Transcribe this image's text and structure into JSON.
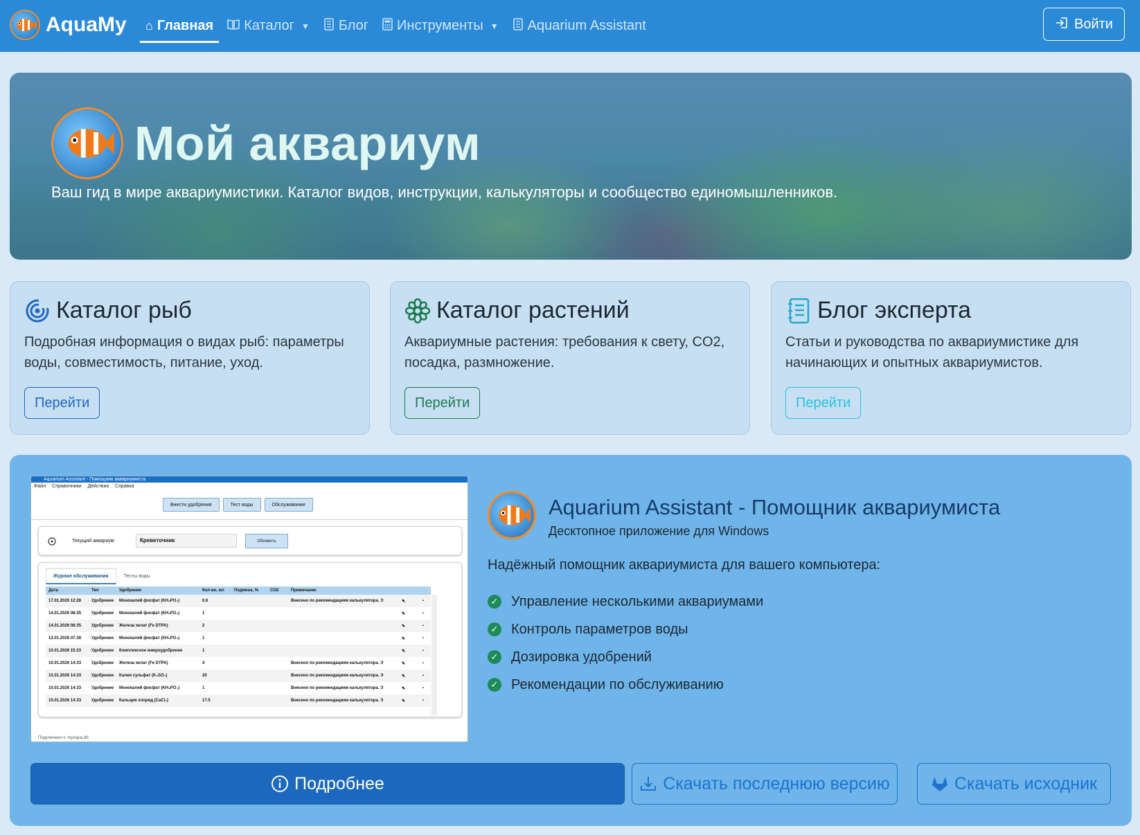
{
  "navbar": {
    "brand": "AquaMy",
    "links": [
      {
        "label": "Главная",
        "icon": "home-icon",
        "active": true
      },
      {
        "label": "Каталог",
        "icon": "book-icon",
        "dropdown": true
      },
      {
        "label": "Блог",
        "icon": "journal-icon"
      },
      {
        "label": "Инструменты",
        "icon": "calculator-icon",
        "dropdown": true
      },
      {
        "label": "Aquarium Assistant",
        "icon": "journal-icon"
      }
    ],
    "login": "Войти"
  },
  "hero": {
    "title": "Мой аквариум",
    "subtitle": "Ваш гид в мире аквариумистики. Каталог видов, инструкции, калькуляторы и сообщество единомышленников."
  },
  "cards": [
    {
      "title": "Каталог рыб",
      "icon": "fish-catalog-icon",
      "text": "Подробная информация о видах рыб: параметры воды, совместимость, питание, уход.",
      "button": "Перейти",
      "color": "#1f67c5"
    },
    {
      "title": "Каталог растений",
      "icon": "flower-icon",
      "text": "Аквариумные растения: требования к свету, CO2, посадка, размножение.",
      "button": "Перейти",
      "color": "#1c7a4d"
    },
    {
      "title": "Блог эксперта",
      "icon": "journal-icon",
      "text": "Статьи и руководства по аквариумистике для начинающих и опытных аквариумистов.",
      "button": "Перейти",
      "color": "#27c3de"
    }
  ],
  "assistant": {
    "title": "Aquarium Assistant - Помощник аквариумиста",
    "subtitle": "Десктопное приложение для Windows",
    "lead": "Надёжный помощник аквариумиста для вашего компьютера:",
    "features": [
      "Управление несколькими аквариумами",
      "Контроль параметров воды",
      "Дозировка удобрений",
      "Рекомендации по обслуживанию"
    ],
    "buttons": {
      "more": "Подробнее",
      "download": "Скачать последнюю версию",
      "source": "Скачать исходник"
    }
  },
  "screenshot": {
    "title": "Aquarium Assistant - Помощник аквариумиста",
    "menu": [
      "Файл",
      "Справочники",
      "Действия",
      "Справка"
    ],
    "toolbar": [
      "Внести удобрения",
      "Тест воды",
      "Обслуживание"
    ],
    "current_label": "Текущий аквариум:",
    "current_value": "Креветочник",
    "refresh": "Обновить",
    "tabs": [
      "Журнал обслуживания",
      "Тесты воды"
    ],
    "columns": [
      "Дата",
      "Тип",
      "Удобрение",
      "Кол-во, мл",
      "Подмена, %",
      "CO2",
      "Примечание"
    ],
    "rows": [
      [
        "17.01.2026 12:28",
        "Удобрение",
        "Монокалий фосфат (KH₂PO₄)",
        "0.6",
        "",
        "",
        "Внесено по рекомендациям калькулятора. Э"
      ],
      [
        "14.01.2026 08:35",
        "Удобрение",
        "Монокалий фосфат (KH₂PO₄)",
        "1",
        "",
        "",
        ""
      ],
      [
        "14.01.2026 08:35",
        "Удобрение",
        "Железа хелат (Fe DTPA)",
        "2",
        "",
        "",
        ""
      ],
      [
        "12.01.2026 07:38",
        "Удобрение",
        "Монокалий фосфат (KH₂PO₄)",
        "1",
        "",
        "",
        ""
      ],
      [
        "10.01.2026 15:23",
        "Удобрение",
        "Комплексное микроудобрение",
        "1",
        "",
        "",
        ""
      ],
      [
        "10.01.2026 14:33",
        "Удобрение",
        "Железа хелат (Fe DTPA)",
        "4",
        "",
        "",
        "Внесено по рекомендациям калькулятора. Э"
      ],
      [
        "10.01.2026 14:33",
        "Удобрение",
        "Калия сульфат (K₂SO₄)",
        "20",
        "",
        "",
        "Внесено по рекомендациям калькулятора. Э"
      ],
      [
        "10.01.2026 14:33",
        "Удобрение",
        "Монокалий фосфат (KH₂PO₄)",
        "1",
        "",
        "",
        "Внесено по рекомендациям калькулятора. Э"
      ],
      [
        "10.01.2026 14:33",
        "Удобрение",
        "Кальция хлорид (CaCl₂)",
        "17.5",
        "",
        "",
        "Внесено по рекомендациям калькулятора. Э"
      ]
    ],
    "status": "Подключено к: myAqua.db"
  }
}
